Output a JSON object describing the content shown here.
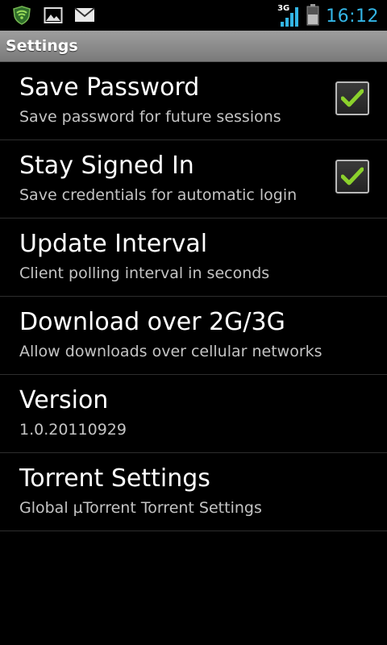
{
  "status_bar": {
    "time": "16:12",
    "network_type": "3G",
    "icons": [
      "shield-icon",
      "image-icon",
      "mail-icon",
      "signal-icon",
      "battery-icon"
    ],
    "time_color": "#33b5e5"
  },
  "title_bar": {
    "title": "Settings"
  },
  "preferences": [
    {
      "title": "Save Password",
      "summary": "Save password for future sessions",
      "checked": true
    },
    {
      "title": "Stay Signed In",
      "summary": "Save credentials for automatic login",
      "checked": true
    },
    {
      "title": "Update Interval",
      "summary": "Client polling interval in seconds"
    },
    {
      "title": "Download over 2G/3G",
      "summary": "Allow downloads over cellular networks"
    },
    {
      "title": "Version",
      "summary": "1.0.20110929"
    },
    {
      "title": "Torrent Settings",
      "summary": "Global µTorrent Torrent Settings"
    }
  ],
  "colors": {
    "check_mark": "#8bd12c",
    "title_bar": "#8a8a8a"
  }
}
